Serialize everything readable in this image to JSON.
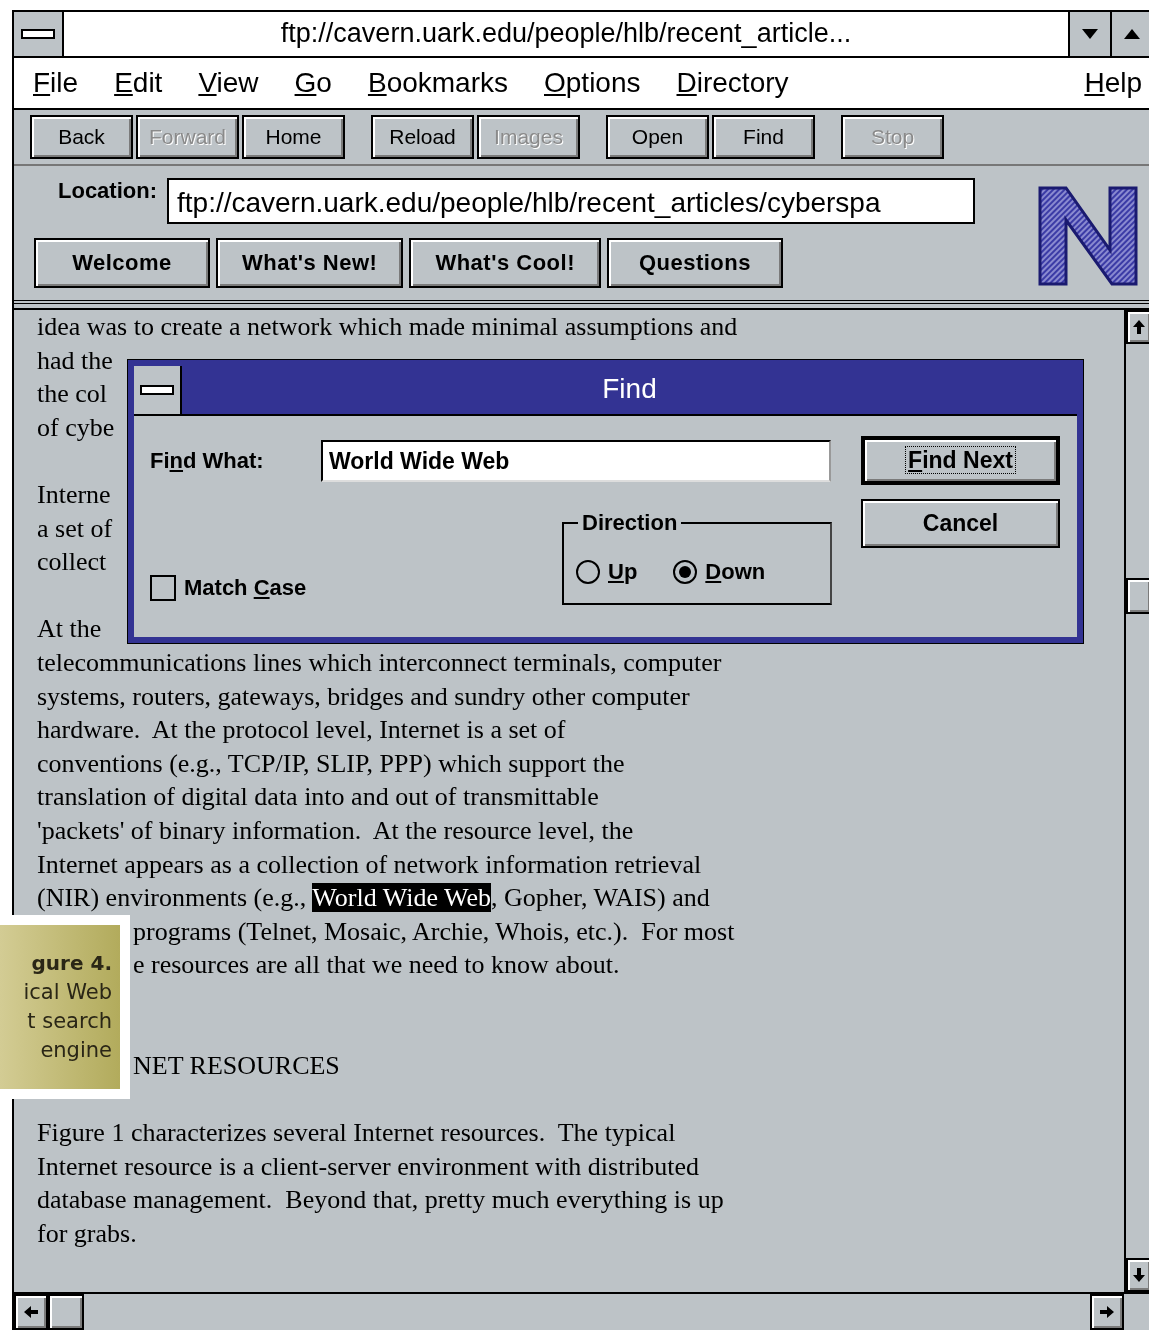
{
  "window": {
    "title": "ftp://cavern.uark.edu/people/hlb/recent_article..."
  },
  "menu": [
    {
      "key": "F",
      "after": "ile"
    },
    {
      "key": "E",
      "after": "dit"
    },
    {
      "key": "V",
      "after": "iew"
    },
    {
      "key": "G",
      "after": "o"
    },
    {
      "key": "B",
      "after": "ookmarks"
    },
    {
      "key": "O",
      "after": "ptions"
    },
    {
      "key": "D",
      "after": "irectory"
    },
    {
      "key": "H",
      "after": "elp"
    }
  ],
  "toolbar": {
    "groups": [
      [
        {
          "label": "Back",
          "disabled": false
        },
        {
          "label": "Forward",
          "disabled": true
        },
        {
          "label": "Home",
          "disabled": false
        }
      ],
      [
        {
          "label": "Reload",
          "disabled": false
        },
        {
          "label": "Images",
          "disabled": true
        }
      ],
      [
        {
          "label": "Open",
          "disabled": false
        },
        {
          "label": "Find",
          "disabled": false
        }
      ],
      [
        {
          "label": "Stop",
          "disabled": true
        }
      ]
    ]
  },
  "location": {
    "label": "Location:",
    "value": "ftp://cavern.uark.edu/people/hlb/recent_articles/cyberspa"
  },
  "directory_buttons": [
    "Welcome",
    "What's New!",
    "What's Cool!",
    "Questions"
  ],
  "document": {
    "lines": [
      {
        "kind": "text",
        "parts": [
          {
            "text": "idea was to create a network which made minimal assumptions and",
            "selected": false
          }
        ]
      },
      {
        "kind": "text",
        "parts": [
          {
            "text": "had the",
            "selected": false
          }
        ]
      },
      {
        "kind": "text",
        "parts": [
          {
            "text": "the col",
            "selected": false
          }
        ]
      },
      {
        "kind": "text",
        "parts": [
          {
            "text": "of cybe",
            "selected": false
          }
        ]
      },
      {
        "kind": "blank"
      },
      {
        "kind": "text",
        "parts": [
          {
            "text": "Interne",
            "selected": false
          }
        ]
      },
      {
        "kind": "text",
        "parts": [
          {
            "text": "a set of",
            "selected": false
          }
        ]
      },
      {
        "kind": "text",
        "parts": [
          {
            "text": "collect",
            "selected": false
          }
        ]
      },
      {
        "kind": "blank"
      },
      {
        "kind": "text",
        "parts": [
          {
            "text": "At the",
            "selected": false
          }
        ]
      },
      {
        "kind": "text",
        "parts": [
          {
            "text": "telecommunications lines which interconnect terminals, computer",
            "selected": false
          }
        ]
      },
      {
        "kind": "text",
        "parts": [
          {
            "text": "systems, routers, gateways, bridges and sundry other computer",
            "selected": false
          }
        ]
      },
      {
        "kind": "text",
        "parts": [
          {
            "text": "hardware.  At the protocol level, Internet is a set of",
            "selected": false
          }
        ]
      },
      {
        "kind": "text",
        "parts": [
          {
            "text": "conventions (e.g., TCP/IP, SLIP, PPP) which support the",
            "selected": false
          }
        ]
      },
      {
        "kind": "text",
        "parts": [
          {
            "text": "translation of digital data into and out of transmittable",
            "selected": false
          }
        ]
      },
      {
        "kind": "text",
        "parts": [
          {
            "text": "'packets' of binary information.  At the resource level, the",
            "selected": false
          }
        ]
      },
      {
        "kind": "text",
        "parts": [
          {
            "text": "Internet appears as a collection of network information retrieval",
            "selected": false
          }
        ]
      },
      {
        "kind": "text",
        "parts": [
          {
            "text": "(NIR) environments (e.g., ",
            "selected": false
          },
          {
            "text": "World Wide Web",
            "selected": true
          },
          {
            "text": ", Gopher, WAIS) and",
            "selected": false
          }
        ]
      },
      {
        "kind": "cut",
        "parts": [
          {
            "text": "programs (Telnet, Mosaic, Archie, Whois, etc.).  For most",
            "selected": false
          }
        ]
      },
      {
        "kind": "cut",
        "parts": [
          {
            "text": "e resources are all that we need to know about.",
            "selected": false
          }
        ]
      },
      {
        "kind": "blank"
      },
      {
        "kind": "blank"
      },
      {
        "kind": "cut",
        "parts": [
          {
            "text": "NET RESOURCES",
            "selected": false
          }
        ]
      },
      {
        "kind": "blank"
      },
      {
        "kind": "text",
        "parts": [
          {
            "text": "Figure 1 characterizes several Internet resources.  The typical",
            "selected": false
          }
        ]
      },
      {
        "kind": "text",
        "parts": [
          {
            "text": "Internet resource is a client-server environment with distributed",
            "selected": false
          }
        ]
      },
      {
        "kind": "text",
        "parts": [
          {
            "text": "database management.  Beyond that, pretty much everything is up",
            "selected": false
          }
        ]
      },
      {
        "kind": "text",
        "parts": [
          {
            "text": "for grabs.",
            "selected": false
          }
        ]
      }
    ]
  },
  "find_dialog": {
    "title": "Find",
    "find_what": {
      "before": "Fi",
      "key": "n",
      "after": "d What:"
    },
    "value": "World Wide Web",
    "match_case": {
      "before": "Match ",
      "key": "C",
      "after": "ase",
      "checked": false
    },
    "direction": {
      "title": "Direction",
      "options": [
        {
          "key": "U",
          "after": "p",
          "selected": false
        },
        {
          "key": "D",
          "after": "own",
          "selected": true
        }
      ]
    },
    "buttons": [
      {
        "key": "F",
        "after": "ind Next",
        "default": true
      },
      {
        "after": "Cancel",
        "default": false
      }
    ]
  },
  "caption": {
    "title": "gure 4.",
    "lines": [
      "ical Web",
      "t search",
      "engine"
    ]
  }
}
